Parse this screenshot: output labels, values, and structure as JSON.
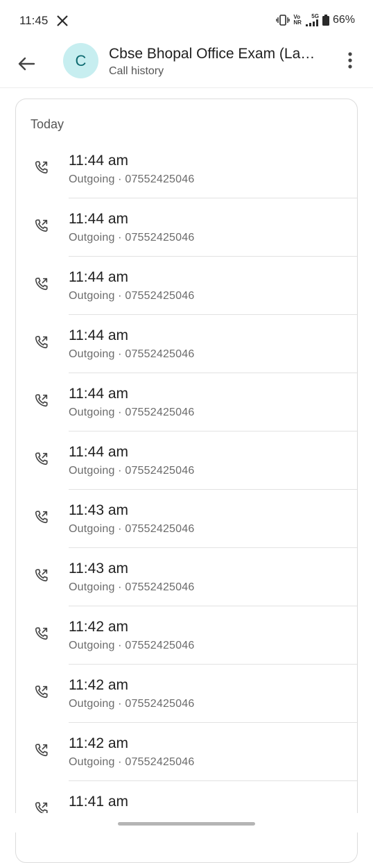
{
  "status_bar": {
    "time": "11:45",
    "net_top": "Vo",
    "net_bottom": "NR",
    "network": "5G",
    "battery": "66%"
  },
  "header": {
    "avatar_letter": "C",
    "contact_name": "Cbse Bhopal Office Exam (La…",
    "subtitle": "Call history"
  },
  "section": {
    "title": "Today"
  },
  "calls": [
    {
      "time": "11:44 am",
      "detail": "Outgoing · 07552425046"
    },
    {
      "time": "11:44 am",
      "detail": "Outgoing · 07552425046"
    },
    {
      "time": "11:44 am",
      "detail": "Outgoing · 07552425046"
    },
    {
      "time": "11:44 am",
      "detail": "Outgoing · 07552425046"
    },
    {
      "time": "11:44 am",
      "detail": "Outgoing · 07552425046"
    },
    {
      "time": "11:44 am",
      "detail": "Outgoing · 07552425046"
    },
    {
      "time": "11:43 am",
      "detail": "Outgoing · 07552425046"
    },
    {
      "time": "11:43 am",
      "detail": "Outgoing · 07552425046"
    },
    {
      "time": "11:42 am",
      "detail": "Outgoing · 07552425046"
    },
    {
      "time": "11:42 am",
      "detail": "Outgoing · 07552425046"
    },
    {
      "time": "11:42 am",
      "detail": "Outgoing · 07552425046"
    },
    {
      "time": "11:41 am",
      "detail": ""
    }
  ],
  "icons": {
    "back": "arrow-left-icon",
    "more": "more-vert-icon",
    "call": "outgoing-call-icon"
  },
  "colors": {
    "avatar_bg": "#c7eef0",
    "avatar_text": "#0d6a70"
  }
}
